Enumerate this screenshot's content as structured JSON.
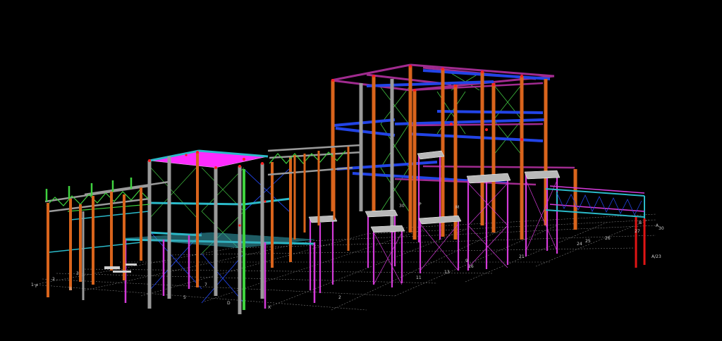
{
  "model_view": {
    "background": "#000000",
    "member_colors": {
      "column_orange": "#d9641c",
      "column_grey": "#9a9a9a",
      "column_magenta": "#d33ad8",
      "column_red": "#e01515",
      "column_green": "#3fd23f",
      "beam_blue": "#2244e6",
      "beam_purple": "#a02b8f",
      "beam_cyan": "#2bb9c8",
      "brace_green": "#40c040",
      "deck_magenta": "#ff2bff",
      "grid_line": "#7a7a7a"
    }
  },
  "grid_labels": [
    {
      "id": "p1",
      "text": "1"
    },
    {
      "id": "p2",
      "text": "P"
    },
    {
      "id": "p3",
      "text": "2"
    },
    {
      "id": "p4",
      "text": "3"
    },
    {
      "id": "p5",
      "text": "B"
    },
    {
      "id": "p6",
      "text": "5"
    },
    {
      "id": "p7",
      "text": "7"
    },
    {
      "id": "p8",
      "text": "D"
    },
    {
      "id": "p9",
      "text": "30"
    },
    {
      "id": "p10",
      "text": "P"
    },
    {
      "id": "p11",
      "text": "M"
    },
    {
      "id": "p12",
      "text": "11"
    },
    {
      "id": "p13",
      "text": "13"
    },
    {
      "id": "p14",
      "text": "16"
    },
    {
      "id": "p15",
      "text": "21"
    },
    {
      "id": "p16",
      "text": "24"
    },
    {
      "id": "p17",
      "text": "25"
    },
    {
      "id": "p18",
      "text": "26"
    },
    {
      "id": "p19",
      "text": "27"
    },
    {
      "id": "p20",
      "text": "A"
    },
    {
      "id": "p21",
      "text": "30"
    },
    {
      "id": "p22",
      "text": "B"
    },
    {
      "id": "p23",
      "text": "A/23"
    },
    {
      "id": "p24",
      "text": "X"
    },
    {
      "id": "p25",
      "text": "2"
    },
    {
      "id": "p26",
      "text": "9"
    }
  ]
}
